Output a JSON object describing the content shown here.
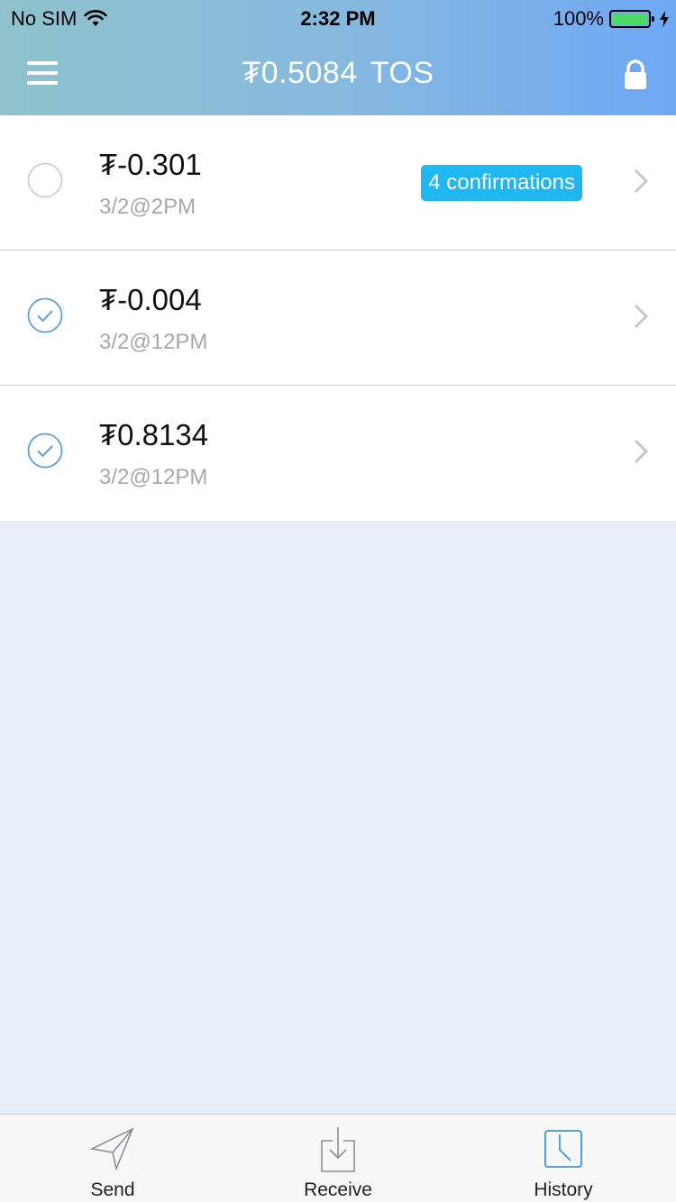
{
  "status_bar": {
    "carrier": "No SIM",
    "time": "2:32 PM",
    "battery": "100%"
  },
  "header": {
    "balance": "₮0.5084",
    "unit": "TOS"
  },
  "transactions": [
    {
      "amount": "₮-0.301",
      "date": "3/2@2PM",
      "badge": "4 confirmations",
      "status": "pending"
    },
    {
      "amount": "₮-0.004",
      "date": "3/2@12PM",
      "badge": "",
      "status": "confirmed"
    },
    {
      "amount": "₮0.8134",
      "date": "3/2@12PM",
      "badge": "",
      "status": "confirmed"
    }
  ],
  "tab_bar": {
    "send_label": "Send",
    "receive_label": "Receive",
    "history_label": "History",
    "active": "history"
  },
  "colors": {
    "accent": "#1fb6f2",
    "check": "#5d9fe0",
    "history_active": "#3a96dd",
    "background": "#e7eef7"
  }
}
